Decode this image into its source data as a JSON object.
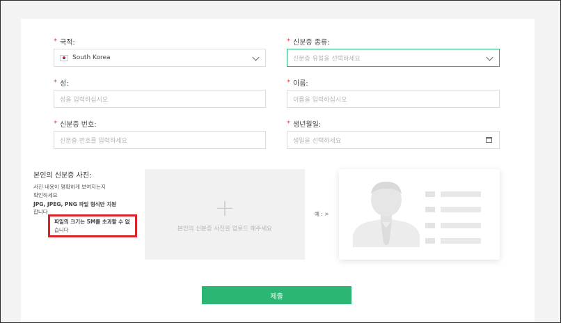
{
  "form": {
    "required_mark": "*",
    "nationality": {
      "label": "국적:",
      "value": "South Korea"
    },
    "id_type": {
      "label": "신분증 종류:",
      "placeholder": "신분증 유형을 선택하세요"
    },
    "last_name": {
      "label": "성:",
      "placeholder": "성을 입력하십시오"
    },
    "first_name": {
      "label": "이름:",
      "placeholder": "이름을 입력하십시오"
    },
    "id_number": {
      "label": "신분증 번호:",
      "placeholder": "신분증 번호를 입력하세요"
    },
    "birth_date": {
      "label": "생년월일:",
      "placeholder": "생일을 선택하세요"
    }
  },
  "upload": {
    "title": "본인의 신분증 사진:",
    "desc_line1": "사진 내용이 명확하게 보여지는지",
    "desc_line2": "확인하세요",
    "desc_line3": "JPG, JPEG, PNG 파일 형식만 지원",
    "desc_line4": "합니다",
    "desc_line5": "파일의 크기는 5M를 초과할 수 없",
    "desc_line6": "습니다",
    "area_text": "본인의 신분증 사진을 업로드 해주세요",
    "example_label": "예 : >"
  },
  "submit_label": "제출",
  "colors": {
    "accent": "#2bb673",
    "highlight": "#d8232a"
  }
}
